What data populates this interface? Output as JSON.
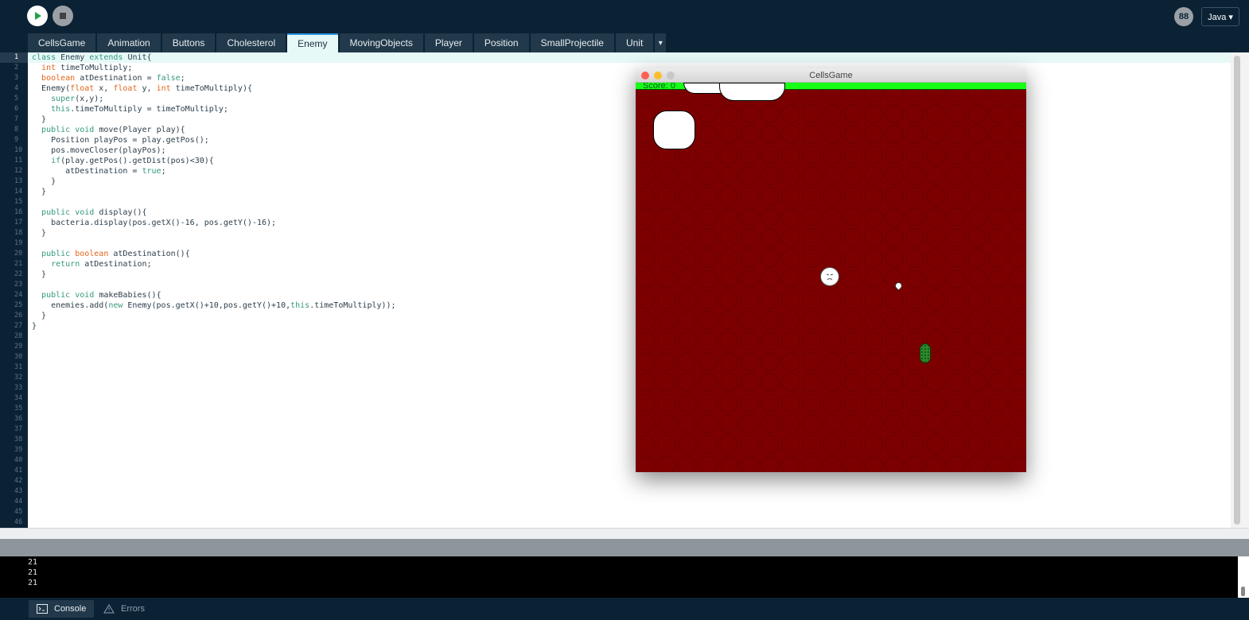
{
  "toolbar": {
    "mode_label": "Java ▾",
    "tweak_label": "88"
  },
  "tabs": [
    "CellsGame",
    "Animation",
    "Buttons",
    "Cholesterol",
    "Enemy",
    "MovingObjects",
    "Player",
    "Position",
    "SmallProjectile",
    "Unit"
  ],
  "active_tab": "Enemy",
  "tab_overflow_label": "▾",
  "code_lines": [
    "class Enemy extends Unit{",
    "  int timeToMultiply;",
    "  boolean atDestination = false;",
    "  Enemy(float x, float y, int timeToMultiply){",
    "    super(x,y);",
    "    this.timeToMultiply = timeToMultiply;",
    "  }",
    "  public void move(Player play){",
    "    Position playPos = play.getPos();",
    "    pos.moveCloser(playPos);",
    "    if(play.getPos().getDist(pos)<30){",
    "       atDestination = true;",
    "    }",
    "  }",
    "",
    "  public void display(){",
    "    bacteria.display(pos.getX()-16, pos.getY()-16);",
    "  }",
    "",
    "  public boolean atDestination(){",
    "    return atDestination;",
    "  }",
    "",
    "  public void makeBabies(){",
    "    enemies.add(new Enemy(pos.getX()+10,pos.getY()+10,this.timeToMultiply));",
    "  }",
    "}"
  ],
  "line_count": 46,
  "sketch": {
    "title": "CellsGame",
    "score_label": "Score: 0"
  },
  "console": {
    "lines": [
      "21",
      "21",
      "21"
    ]
  },
  "bottom_tabs": {
    "console_label": "Console",
    "errors_label": "Errors"
  }
}
